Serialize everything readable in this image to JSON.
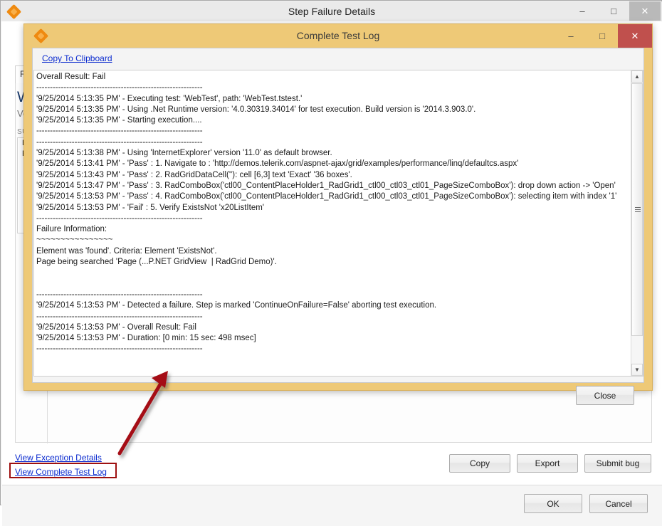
{
  "outer_window": {
    "title": "Step Failure Details",
    "app_icon": "telerik-diamond-icon",
    "controls": {
      "minimize": "–",
      "maximize": "□",
      "close": "✕"
    },
    "background_panel": {
      "tab_label": "Fail",
      "heading": "We",
      "subheading": "Ver",
      "section_label": "SUM",
      "box_lines": [
        "E1",
        "Pa"
      ]
    },
    "footer_links": [
      {
        "label": "View Exception Details"
      },
      {
        "label": "View Complete Test Log"
      }
    ],
    "action_buttons": [
      {
        "label": "Copy"
      },
      {
        "label": "Export"
      },
      {
        "label": "Submit bug"
      }
    ],
    "dialog_buttons": [
      {
        "label": "OK"
      },
      {
        "label": "Cancel"
      }
    ]
  },
  "inner_dialog": {
    "title": "Complete Test Log",
    "app_icon": "telerik-diamond-icon",
    "controls": {
      "minimize": "–",
      "maximize": "□",
      "close": "✕"
    },
    "toolbar": {
      "copy_to_clipboard": "Copy To Clipboard"
    },
    "close_button": "Close",
    "scrollbar": {
      "up_arrow": "▲",
      "down_arrow": "▼"
    },
    "log_text": "Overall Result: Fail\n-------------------------------------------------------------\n'9/25/2014 5:13:35 PM' - Executing test: 'WebTest', path: 'WebTest.tstest.'\n'9/25/2014 5:13:35 PM' - Using .Net Runtime version: '4.0.30319.34014' for test execution. Build version is '2014.3.903.0'.\n'9/25/2014 5:13:35 PM' - Starting execution....\n-------------------------------------------------------------\n-------------------------------------------------------------\n'9/25/2014 5:13:38 PM' - Using 'InternetExplorer' version '11.0' as default browser.\n'9/25/2014 5:13:41 PM' - 'Pass' : 1. Navigate to : 'http://demos.telerik.com/aspnet-ajax/grid/examples/performance/linq/defaultcs.aspx'\n'9/25/2014 5:13:43 PM' - 'Pass' : 2. RadGridDataCell(''): cell [6,3] text 'Exact' '36 boxes'.\n'9/25/2014 5:13:47 PM' - 'Pass' : 3. RadComboBox('ctl00_ContentPlaceHolder1_RadGrid1_ctl00_ctl03_ctl01_PageSizeComboBox'): drop down action -> 'Open'\n'9/25/2014 5:13:53 PM' - 'Pass' : 4. RadComboBox('ctl00_ContentPlaceHolder1_RadGrid1_ctl00_ctl03_ctl01_PageSizeComboBox'): selecting item with index '1'\n'9/25/2014 5:13:53 PM' - 'Fail' : 5. Verify ExistsNot 'x20ListItem'\n-------------------------------------------------------------\nFailure Information:\n~~~~~~~~~~~~~~~~\nElement was 'found'. Criteria: Element 'ExistsNot'.\nPage being searched 'Page (...P.NET GridView  | RadGrid Demo)'.\n\n\n-------------------------------------------------------------\n'9/25/2014 5:13:53 PM' - Detected a failure. Step is marked 'ContinueOnFailure=False' aborting test execution.\n-------------------------------------------------------------\n'9/25/2014 5:13:53 PM' - Overall Result: Fail\n'9/25/2014 5:13:53 PM' - Duration: [0 min: 15 sec: 498 msec]\n-------------------------------------------------------------"
  },
  "annotation": {
    "arrow_color": "#a50f12",
    "highlight_color": "#9e1010",
    "highlighted_link": "View Complete Test Log"
  }
}
